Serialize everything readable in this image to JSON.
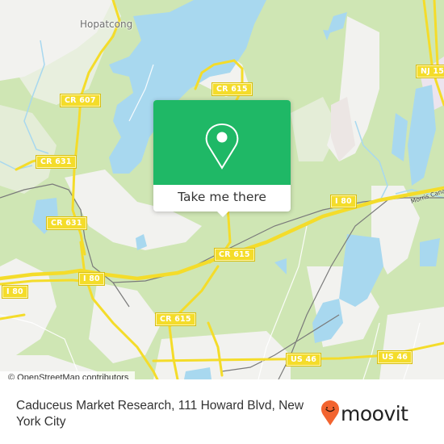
{
  "map": {
    "place_labels": [
      {
        "name": "Hopatcong"
      }
    ],
    "road_labels": [
      {
        "id": "cr607",
        "text": "CR 607"
      },
      {
        "id": "cr615-top",
        "text": "CR 615"
      },
      {
        "id": "nj15",
        "text": "NJ 15"
      },
      {
        "id": "cr631-a",
        "text": "CR 631"
      },
      {
        "id": "cr631-b",
        "text": "CR 631"
      },
      {
        "id": "i80-right",
        "text": "I 80"
      },
      {
        "id": "i80-mid",
        "text": "I 80"
      },
      {
        "id": "i80-left",
        "text": "I 80"
      },
      {
        "id": "cr615-mid",
        "text": "CR 615"
      },
      {
        "id": "cr615-bottom",
        "text": "CR 615"
      },
      {
        "id": "us46-a",
        "text": "US 46"
      },
      {
        "id": "us46-b",
        "text": "US 46"
      }
    ],
    "waterway_label": "Morris Canal",
    "attribution": "© OpenStreetMap contributors",
    "colors": {
      "forest": "#cfe6b4",
      "land": "#f2f2ef",
      "water": "#a8d8ef",
      "road": "#f4dc2a",
      "rail": "#777777"
    }
  },
  "popup": {
    "icon": "map-pin-icon",
    "action_label": "Take me there",
    "accent": "#1fb866"
  },
  "footer": {
    "address": "Caduceus Market Research, 111 Howard Blvd, New York City",
    "brand": "moovit",
    "brand_icon": "moovit-smile-pin-icon",
    "brand_color": "#f26430"
  }
}
